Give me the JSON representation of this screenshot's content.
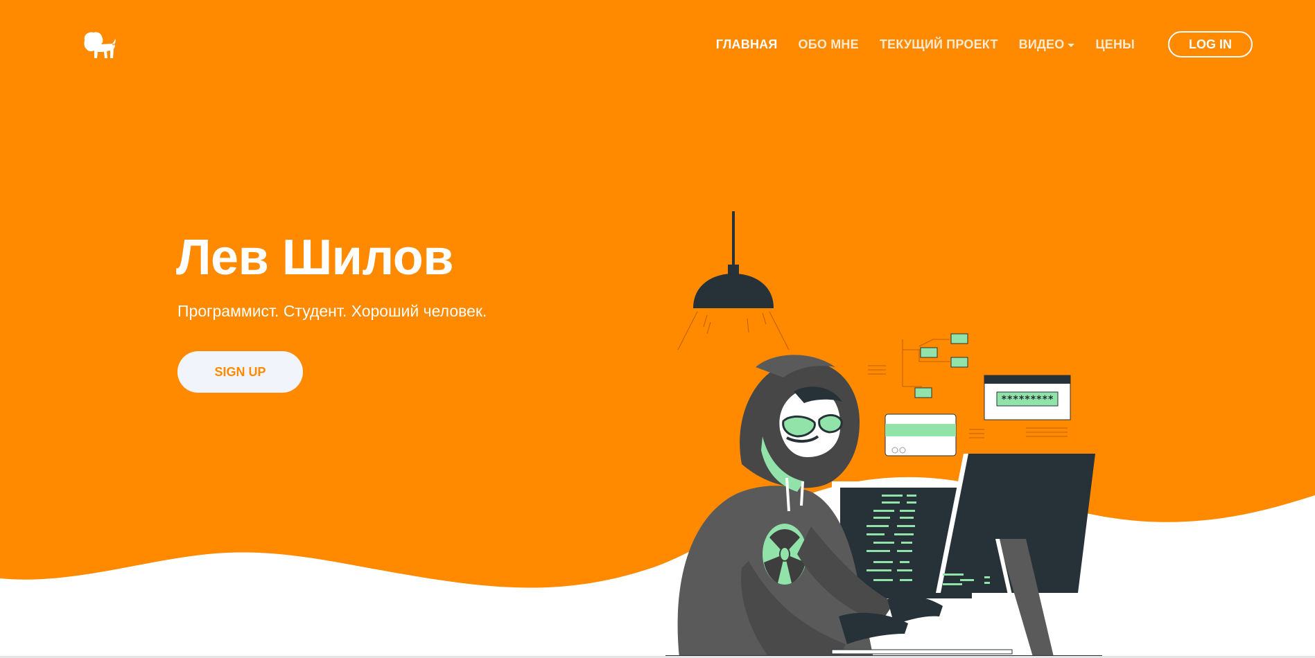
{
  "colors": {
    "hero_bg": "#ff8a00",
    "accent": "#ff8a00",
    "white": "#ffffff",
    "dark": "#263238",
    "green": "#92e3a9"
  },
  "header": {
    "logo_icon": "lion-icon",
    "nav": [
      {
        "label": "ГЛАВНАЯ",
        "active": true
      },
      {
        "label": "ОБО МНЕ"
      },
      {
        "label": "ТЕКУЩИЙ ПРОЕКТ"
      },
      {
        "label": "ВИДЕО",
        "icon": "caret-down-icon"
      },
      {
        "label": "ЦЕНЫ"
      }
    ],
    "login_label": "LOG IN"
  },
  "hero": {
    "title": "Лев Шилов",
    "subtitle": "Программист. Студент. Хороший человек.",
    "cta_label": "SIGN UP"
  },
  "illustration": {
    "password_text": "*********"
  }
}
